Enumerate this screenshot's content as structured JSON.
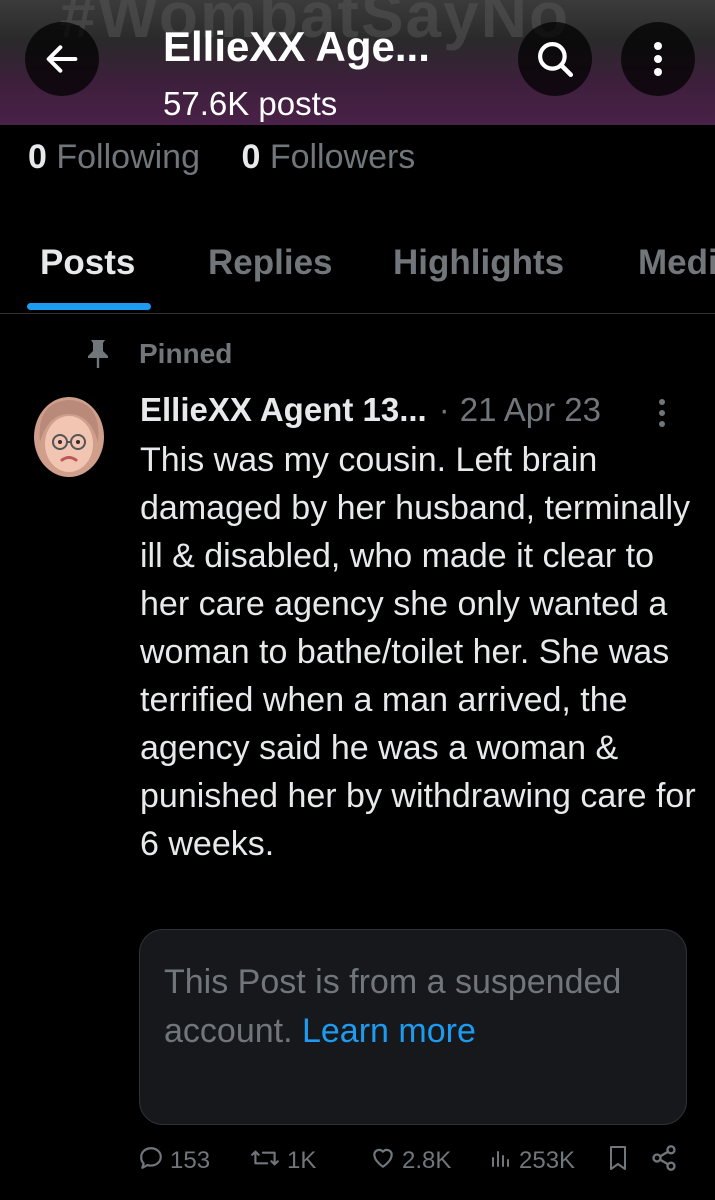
{
  "header": {
    "banner_text": "#WombatSayNo",
    "title": "EllieXX Age...",
    "post_count": "57.6K posts",
    "icons": {
      "back": "back-arrow-icon",
      "search": "search-icon",
      "more": "more-vertical-icon"
    }
  },
  "profile": {
    "following_count": "0",
    "following_label": "Following",
    "followers_count": "0",
    "followers_label": "Followers"
  },
  "tabs": [
    {
      "label": "Posts",
      "active": true
    },
    {
      "label": "Replies",
      "active": false
    },
    {
      "label": "Highlights",
      "active": false
    },
    {
      "label": "Media",
      "active": false
    }
  ],
  "post": {
    "pinned_label": "Pinned",
    "author": "EllieXX Agent 13...",
    "separator": "·",
    "date": "21 Apr 23",
    "text": "This was my cousin. Left brain damaged by her husband, terminally ill & disabled, who made it clear to her care agency she only wanted a woman to bathe/toilet her. She was terrified when a man arrived, the agency said he was a woman & punished her by withdrawing care for 6 weeks.",
    "notice_text": "This Post is from a suspended account. ",
    "notice_link": "Learn more",
    "stats": {
      "replies": "153",
      "reposts": "1K",
      "likes": "2.8K",
      "views": "253K"
    }
  },
  "colors": {
    "background": "#000000",
    "text": "#e7e9ea",
    "muted": "#71767b",
    "accent": "#1d9bf0",
    "card": "#16181c"
  }
}
